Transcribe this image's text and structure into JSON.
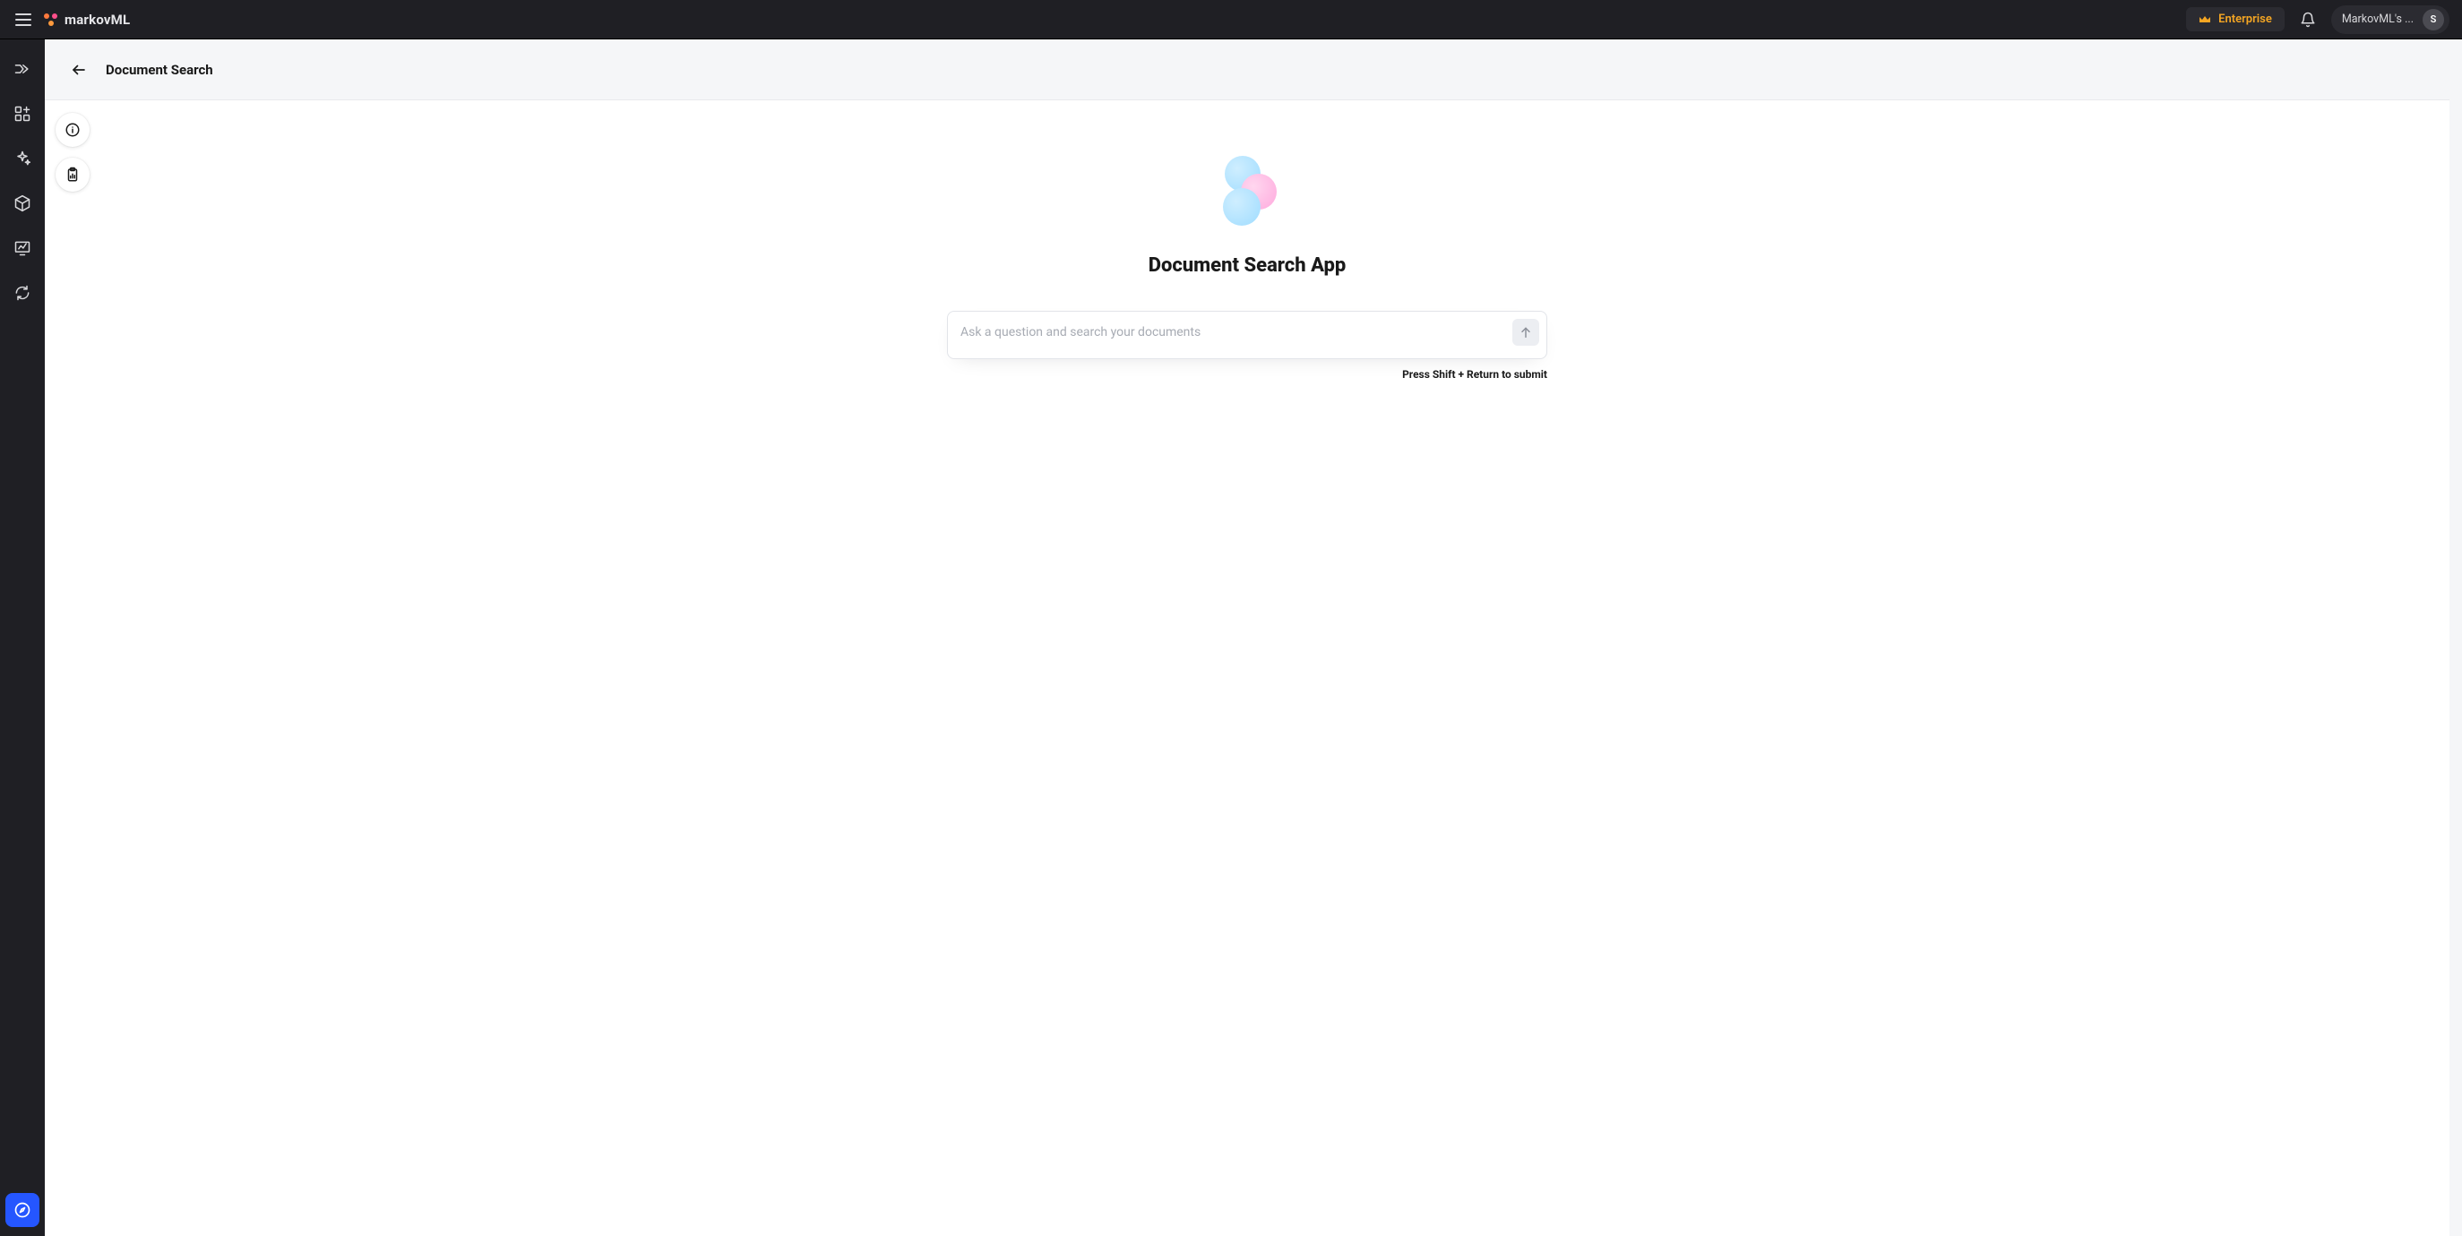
{
  "header": {
    "brand_name": "markovML",
    "enterprise_label": "Enterprise",
    "workspace_label": "MarkovML's ...",
    "avatar_initial": "S"
  },
  "page": {
    "title": "Document Search"
  },
  "hero": {
    "title": "Document Search App",
    "placeholder": "Ask a question and search your documents",
    "submit_hint": "Press Shift + Return to submit"
  }
}
